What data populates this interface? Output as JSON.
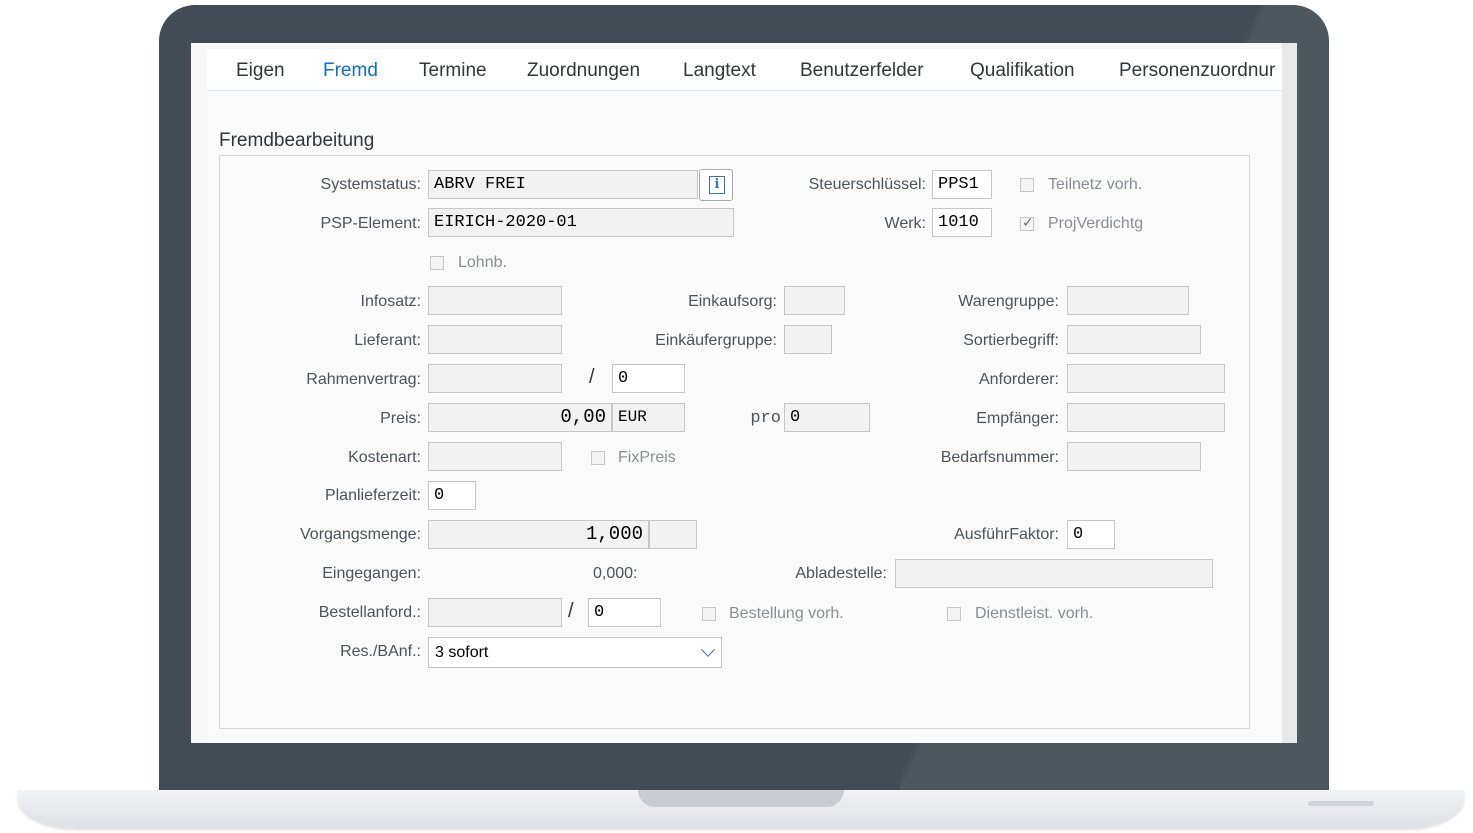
{
  "tabs": [
    "Eigen",
    "Fremd",
    "Termine",
    "Zuordnungen",
    "Langtext",
    "Benutzerfelder",
    "Qualifikation",
    "Personenzuordnur"
  ],
  "group_title": "Fremdbearbeitung",
  "labels": {
    "systemstatus": "Systemstatus:",
    "psp_element": "PSP-Element:",
    "steuerschluessel": "Steuerschlüssel:",
    "werk": "Werk:",
    "infosatz": "Infosatz:",
    "einkaufsorg": "Einkaufsorg:",
    "warengruppe": "Warengruppe:",
    "lieferant": "Lieferant:",
    "einkaeufergruppe": "Einkäufergruppe:",
    "sortierbegriff": "Sortierbegriff:",
    "rahmenvertrag": "Rahmenvertrag:",
    "anforderer": "Anforderer:",
    "preis": "Preis:",
    "pro": "pro",
    "empfaenger": "Empfänger:",
    "kostenart": "Kostenart:",
    "bedarfsnummer": "Bedarfsnummer:",
    "planlieferzeit": "Planlieferzeit:",
    "vorgangsmenge": "Vorgangsmenge:",
    "ausfuehrfaktor": "AusführFaktor:",
    "eingegangen": "Eingegangen:",
    "abladestelle": "Abladestelle:",
    "bestellanford": "Bestellanford.:",
    "res_banf": "Res./BAnf.:"
  },
  "values": {
    "systemstatus": "ABRV FREI",
    "psp_element": "EIRICH-2020-01",
    "steuerschluessel": "PPS1",
    "werk": "1010",
    "infosatz": "",
    "einkaufsorg": "",
    "warengruppe": "",
    "lieferant": "",
    "einkaeufergruppe": "",
    "sortierbegriff": "",
    "rahmenvertrag": "",
    "rahmenvertrag_pos": "0",
    "anforderer": "",
    "preis": "0,00",
    "waehrung": "EUR",
    "pro": "0",
    "empfaenger": "",
    "kostenart": "",
    "bedarfsnummer": "",
    "planlieferzeit": "0",
    "vorgangsmenge": "1,000",
    "mengeneinheit": "",
    "ausfuehrfaktor": "0",
    "eingegangen": "0,000:",
    "abladestelle": "",
    "bestellanford": "",
    "bestellanford_pos": "0",
    "res_banf": "3 sofort"
  },
  "slash": "/",
  "checkboxes": {
    "teilnetz": {
      "label": "Teilnetz vorh.",
      "checked": false
    },
    "projverdichtg": {
      "label": "ProjVerdichtg",
      "checked": true
    },
    "lohnb": {
      "label": "Lohnb.",
      "checked": false
    },
    "fixpreis": {
      "label": "FixPreis",
      "checked": false
    },
    "bestellung": {
      "label": "Bestellung vorh.",
      "checked": false
    },
    "dienstleist": {
      "label": "Dienstleist. vorh.",
      "checked": false
    }
  },
  "check_glyph": "✓",
  "info_glyph": "i",
  "colors": {
    "accent": "#0a6ed1",
    "bezel": "#434c54"
  }
}
